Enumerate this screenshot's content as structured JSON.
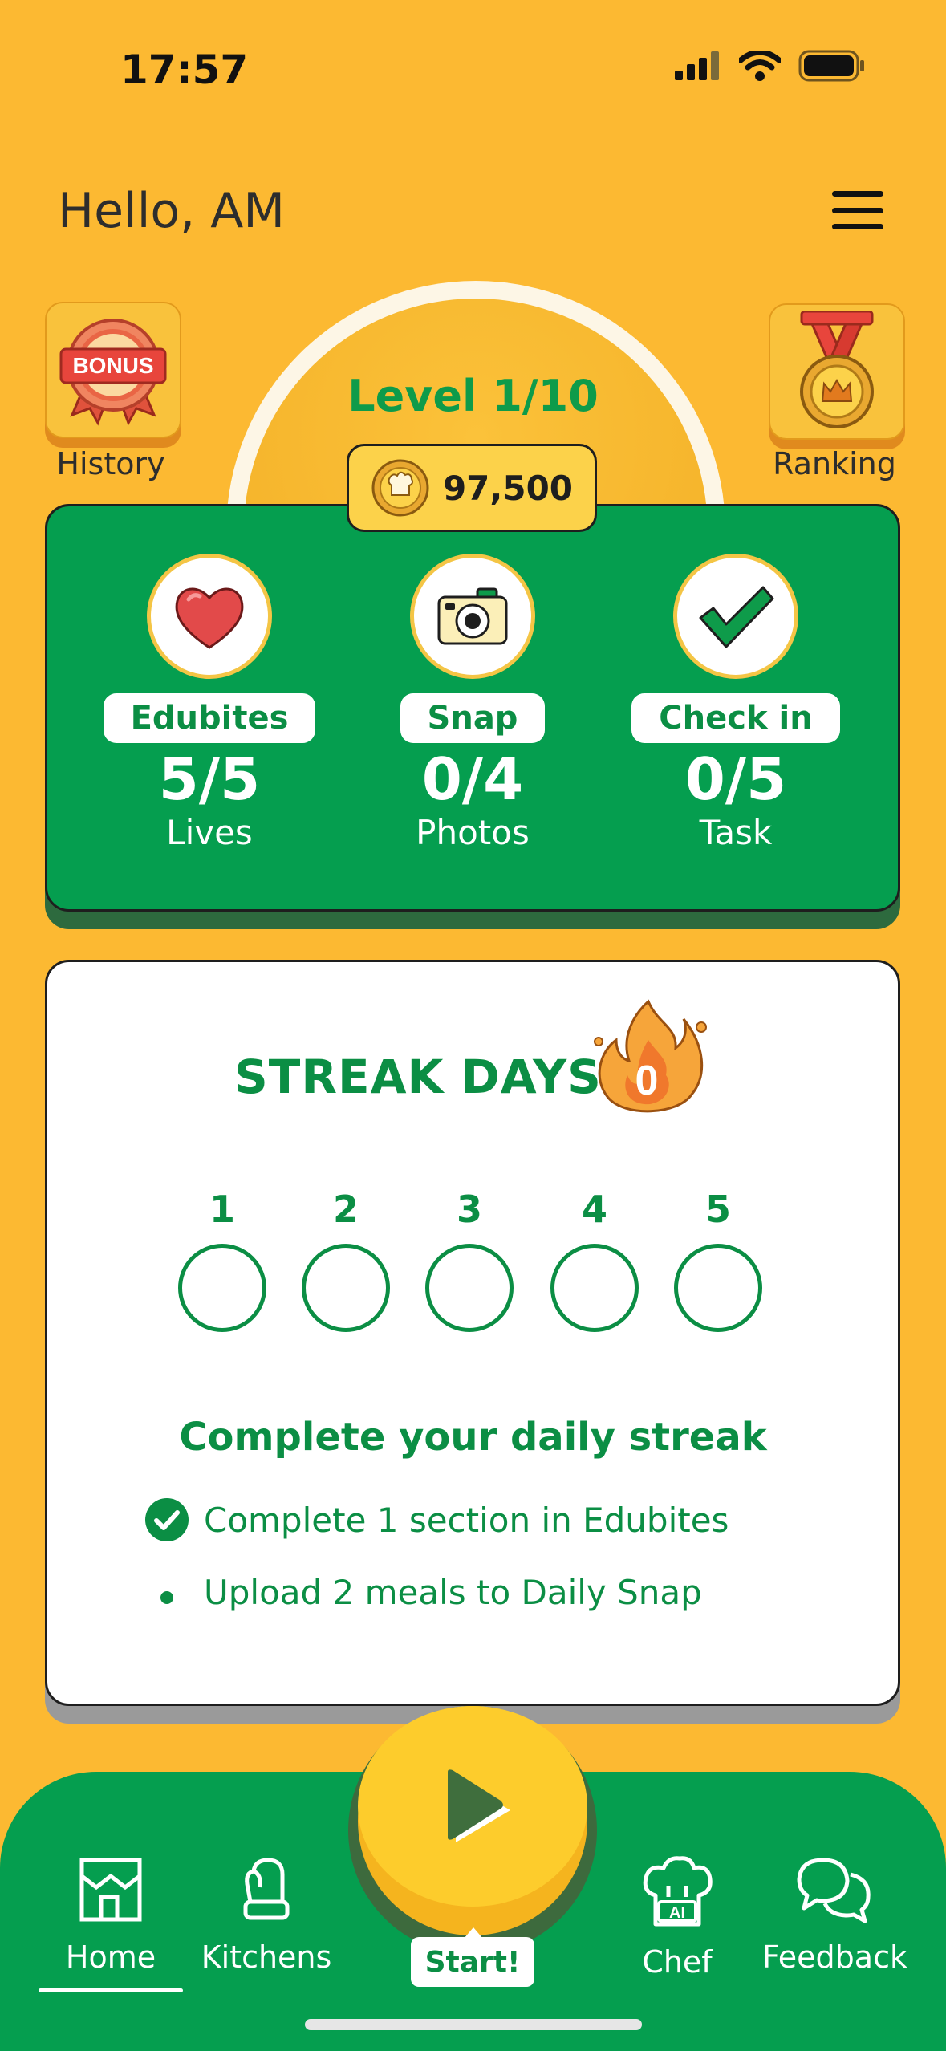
{
  "status_bar": {
    "time": "17:57"
  },
  "header": {
    "greeting": "Hello, AM"
  },
  "left_tile": {
    "badge_text": "BONUS",
    "label": "History"
  },
  "right_tile": {
    "label": "Ranking"
  },
  "level": {
    "title": "Level 1/10",
    "coins": "97,500"
  },
  "stats": [
    {
      "pill": "Edubites",
      "value": "5/5",
      "label": "Lives",
      "icon": "heart-icon"
    },
    {
      "pill": "Snap",
      "value": "0/4",
      "label": "Photos",
      "icon": "camera-icon"
    },
    {
      "pill": "Check in",
      "value": "0/5",
      "label": "Task",
      "icon": "checkmark-icon"
    }
  ],
  "streak": {
    "title": "STREAK DAYS",
    "count": "0",
    "days": [
      "1",
      "2",
      "3",
      "4",
      "5"
    ],
    "subtitle": "Complete your daily streak",
    "tasks": [
      {
        "text": "Complete 1 section in Edubites",
        "done": true
      },
      {
        "text": "Upload 2 meals to Daily Snap",
        "done": false
      }
    ]
  },
  "nav": {
    "items": [
      {
        "label": "Home",
        "icon": "storefront-icon",
        "active": true
      },
      {
        "label": "Kitchens",
        "icon": "oven-mitt-icon",
        "active": false
      },
      {
        "label": "Chef",
        "icon": "ai-chef-hat-icon",
        "active": false
      },
      {
        "label": "Feedback",
        "icon": "chat-bubbles-icon",
        "active": false
      }
    ],
    "start_label": "Start!",
    "ai_badge": "AI"
  },
  "colors": {
    "background": "#FCB932",
    "primary_green": "#059E4F",
    "text_green": "#0B8E44",
    "accent_yellow": "#FDCC2C"
  }
}
